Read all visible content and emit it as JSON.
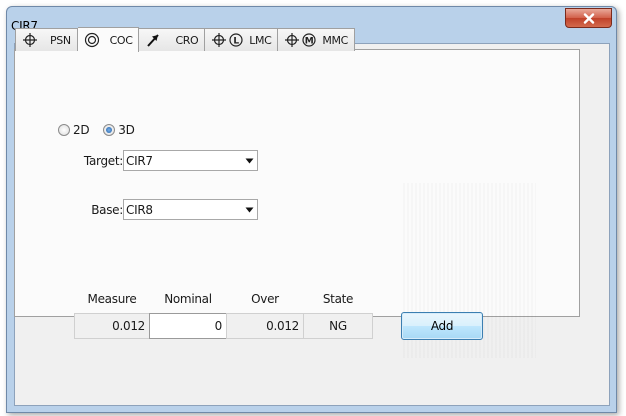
{
  "window": {
    "title": "CIR7",
    "close_label": "x"
  },
  "tabs": [
    {
      "icon": "position-crosshair-icon",
      "label": "PSN",
      "active": false
    },
    {
      "icon": "concentricity-icon",
      "label": "COC",
      "active": true
    },
    {
      "icon": "circular-runout-arrow-icon",
      "label": "CRO",
      "active": false
    },
    {
      "icon": "position-lmc-icon",
      "label": "LMC",
      "active": false
    },
    {
      "icon": "position-mmc-icon",
      "label": "MMC",
      "active": false
    }
  ],
  "mode": {
    "options": [
      {
        "label": "2D",
        "selected": false
      },
      {
        "label": "3D",
        "selected": true
      }
    ]
  },
  "target": {
    "label": "Target:",
    "value": "CIR7"
  },
  "base": {
    "label": "Base:",
    "value": "CIR8"
  },
  "results": {
    "headers": {
      "measure": "Measure",
      "nominal": "Nominal",
      "over": "Over",
      "state": "State"
    },
    "measure": "0.012",
    "nominal": "0",
    "over": "0.012",
    "state": "NG"
  },
  "actions": {
    "add_label": "Add"
  },
  "colors": {
    "frame": "#b9d1ea",
    "client": "#f0f0f0",
    "close_red": "#c0412a",
    "radio_selected": "#1f5fa8",
    "button_border": "#3c7fb1"
  }
}
